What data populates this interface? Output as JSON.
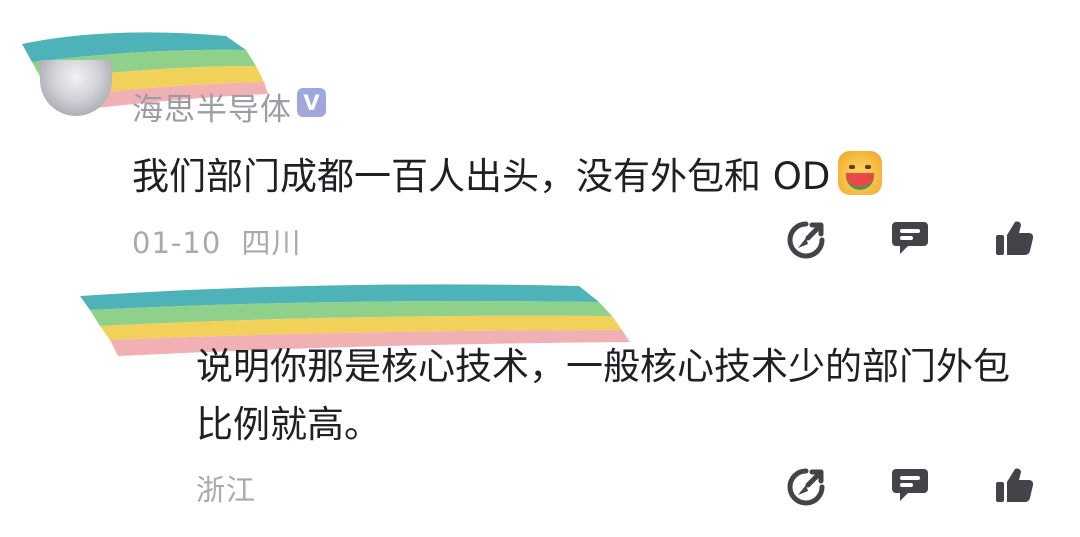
{
  "comment": {
    "username": "海思半导体",
    "verified_badge": "V",
    "text": "我们部门成都一百人出头，没有外包和 OD",
    "emoji_icon": "melon-eater-face-icon",
    "date": "01-10",
    "location": "四川"
  },
  "reply": {
    "text": "说明你那是核心技术，一般核心技术少的部门外包比例就高。",
    "location": "浙江"
  },
  "actions": {
    "icons": [
      "share-icon",
      "reply-icon",
      "like-icon"
    ]
  },
  "colors": {
    "text_primary": "#1f1f24",
    "text_secondary": "#a8a9b1",
    "icon": "#43444a",
    "badge": "#9ea8dd",
    "redaction_stripes": [
      "#4eb3b8",
      "#8fd18a",
      "#f2d15a",
      "#f1b0b4"
    ]
  }
}
